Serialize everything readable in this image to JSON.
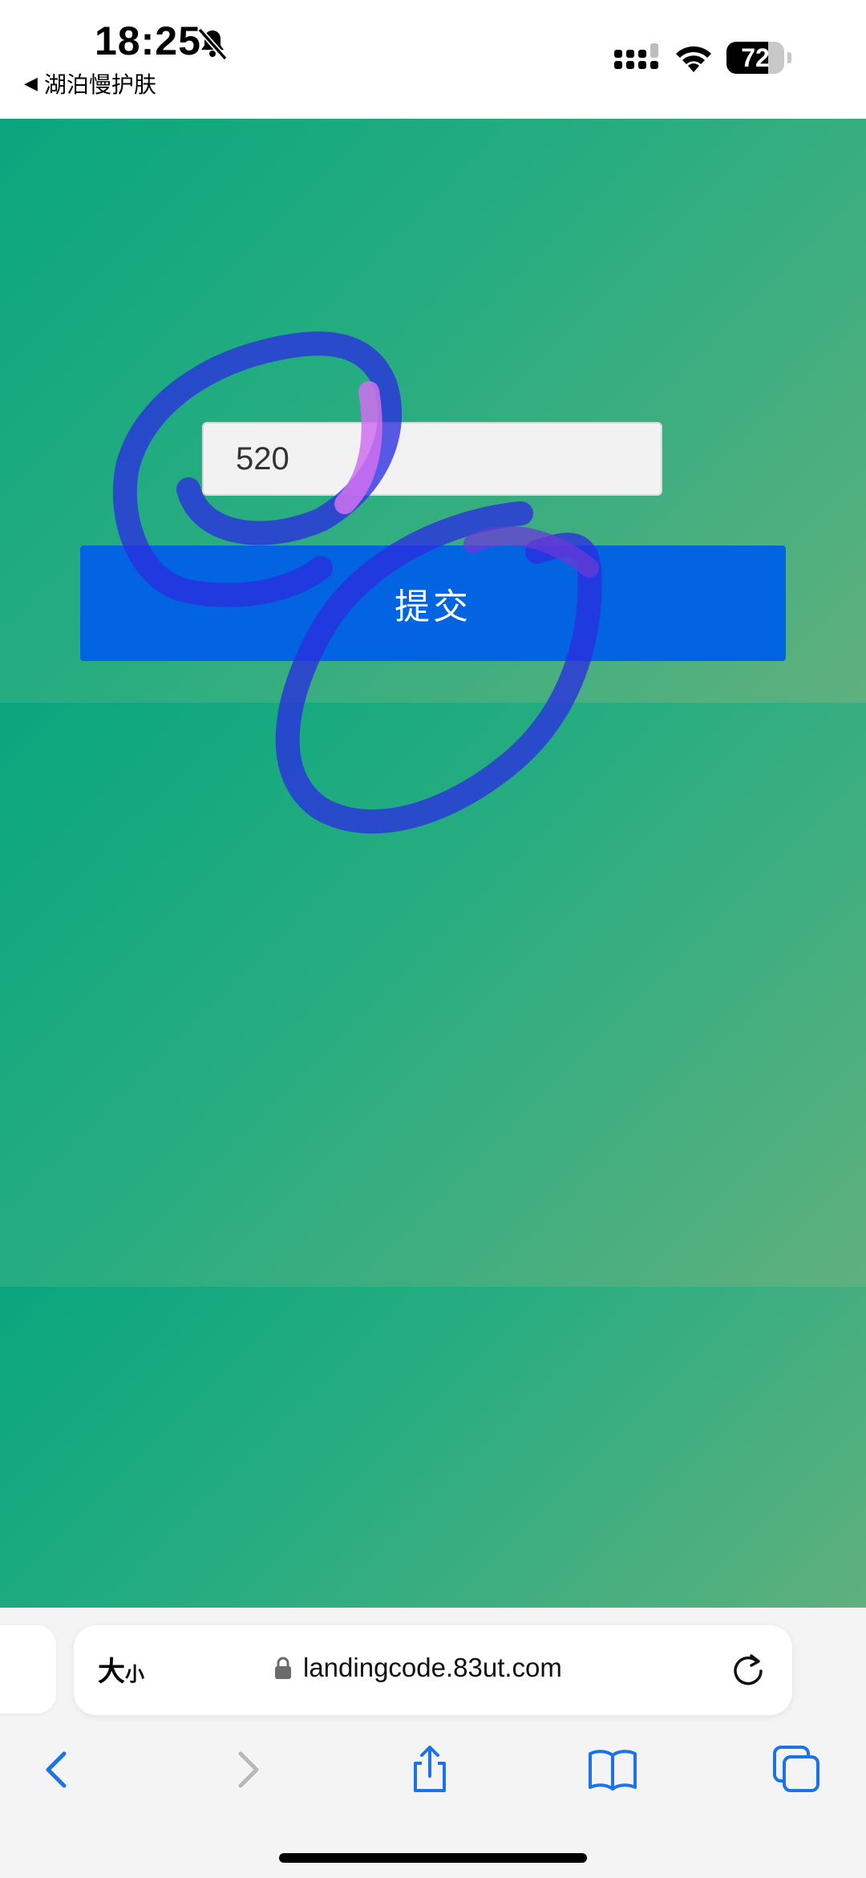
{
  "status_bar": {
    "time": "18:25",
    "back_app": "湖泊慢护肤",
    "battery_level": "72",
    "battery_fraction": 0.72,
    "bell_icon": "bell-slash-icon",
    "signal_icon": "cellular-signal-icon",
    "wifi_icon": "wifi-icon"
  },
  "page": {
    "code_input_value": "520",
    "submit_label": "提交",
    "background_colors": [
      "#0aa67e",
      "#28ad80",
      "#5fb07e"
    ],
    "button_color": "#0264e0",
    "scribble_colors": [
      "#2a2ee0",
      "#d070f0"
    ]
  },
  "safari": {
    "text_size_big": "大",
    "text_size_small": "小",
    "url": "landingcode.83ut.com",
    "icons": {
      "lock": "lock-icon",
      "reload": "reload-icon",
      "back": "chevron-left-icon",
      "forward": "chevron-right-icon",
      "share": "share-icon",
      "bookmarks": "book-icon",
      "tabs": "tabs-icon"
    }
  }
}
